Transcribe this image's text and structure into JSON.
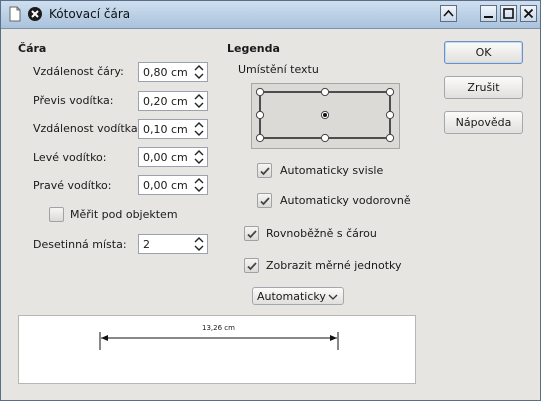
{
  "window": {
    "title": "Kótovací čára"
  },
  "line_section": {
    "title": "Čára",
    "fields": [
      {
        "label": "Vzdálenost čáry:",
        "value": "0,80 cm"
      },
      {
        "label": "Převis vodítka:",
        "value": "0,20 cm"
      },
      {
        "label": "Vzdálenost vodítka:",
        "value": "0,10 cm"
      },
      {
        "label": "Levé vodítko:",
        "value": "0,00 cm"
      },
      {
        "label": "Pravé vodítko:",
        "value": "0,00 cm"
      }
    ],
    "measure_below": {
      "label": "Měřit pod objektem",
      "checked": false
    },
    "decimal": {
      "label": "Desetinná místa:",
      "value": "2"
    }
  },
  "legend_section": {
    "title": "Legenda",
    "text_position_label": "Umístění textu",
    "options": [
      {
        "label": "Automaticky svisle",
        "checked": true
      },
      {
        "label": "Automaticky vodorovně",
        "checked": true
      },
      {
        "label": "Rovnoběžně s čárou",
        "checked": true
      },
      {
        "label": "Zobrazit měrné jednotky",
        "checked": true
      }
    ],
    "units_dropdown": "Automaticky"
  },
  "buttons": {
    "ok": "OK",
    "cancel": "Zrušit",
    "help": "Nápověda"
  },
  "preview": {
    "dimension_text": "13,26 cm"
  }
}
